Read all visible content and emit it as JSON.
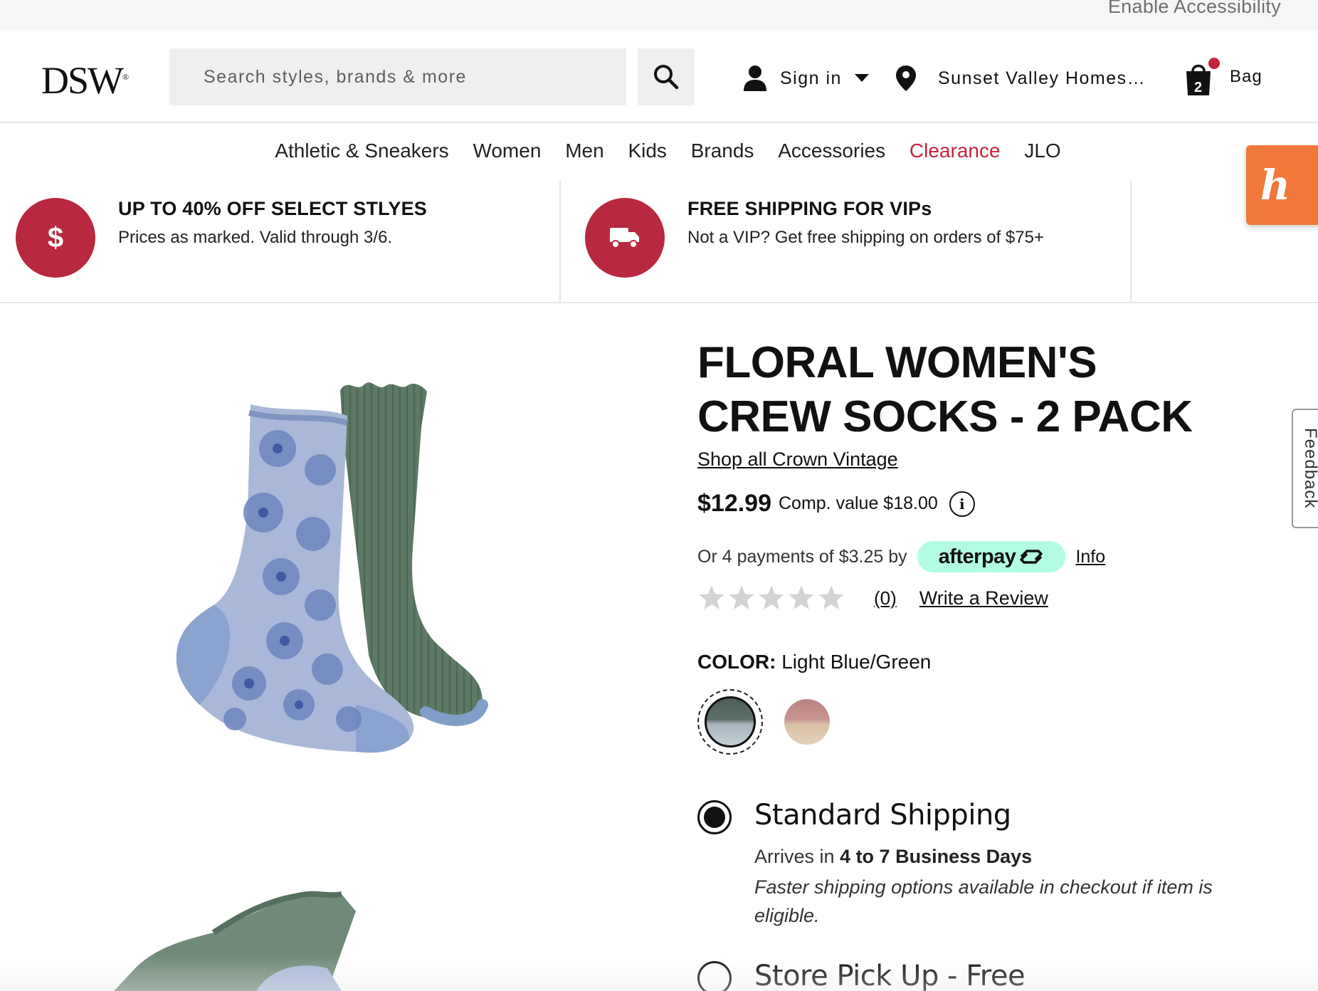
{
  "utility": {
    "accessibility_label": "Enable Accessibility"
  },
  "header": {
    "logo_text": "DSW",
    "logo_mark": "®",
    "search_placeholder": "Search styles, brands & more",
    "signin_label": "Sign in",
    "location_label": "Sunset Valley Homes…",
    "bag_label": "Bag",
    "bag_count": "2"
  },
  "nav": {
    "items": [
      "Athletic & Sneakers",
      "Women",
      "Men",
      "Kids",
      "Brands",
      "Accessories",
      "Clearance",
      "JLO"
    ]
  },
  "promos": [
    {
      "icon_text": "$",
      "title": "UP TO 40% OFF SELECT STLYES",
      "subtitle": "Prices as marked. Valid through 3/6."
    },
    {
      "icon_text": "",
      "title": "FREE SHIPPING FOR VIPs",
      "subtitle": "Not a VIP? Get free shipping on orders of $75+"
    }
  ],
  "honey": {
    "text": "h"
  },
  "product": {
    "title": "FLORAL WOMEN'S CREW SOCKS - 2 PACK",
    "brand_link": "Shop all Crown Vintage",
    "price": "$12.99",
    "comp_value": "Comp. value $18.00",
    "info_glyph": "i",
    "afterpay_text": "Or 4 payments of $3.25 by",
    "afterpay_badge": "afterpay",
    "afterpay_info": "Info",
    "rating": 0,
    "review_count": "(0)",
    "write_review": "Write a Review",
    "color_label": "COLOR:",
    "color_value": "Light Blue/Green"
  },
  "shipping": {
    "standard_title": "Standard Shipping",
    "arrives_prefix": "Arrives in",
    "arrives_days": "4 to 7 Business Days",
    "note": "Faster shipping options available in checkout if item is eligible.",
    "pickup_title": "Store Pick Up - Free"
  },
  "feedback": {
    "label": "Feedback"
  },
  "colors": {
    "brand_red": "#b8283e",
    "clearance_red": "#c4233d",
    "honey_orange": "#f0783a",
    "afterpay_mint": "#b2fce4"
  }
}
